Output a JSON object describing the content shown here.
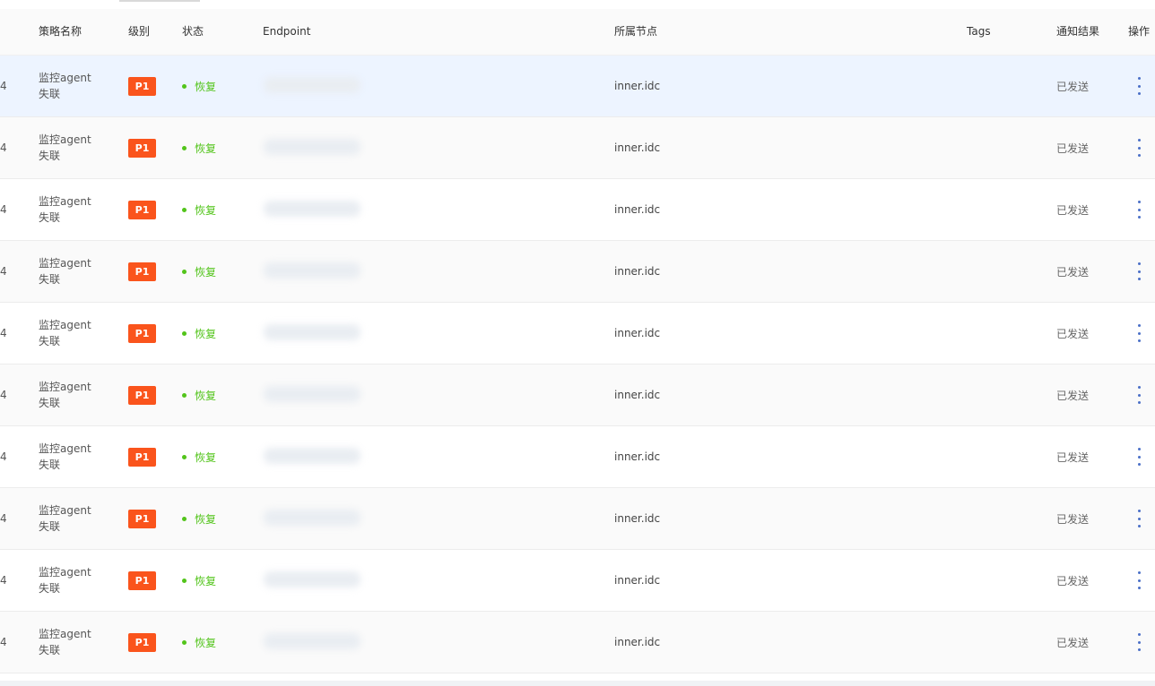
{
  "table": {
    "headers": {
      "name": "策略名称",
      "level": "级别",
      "status": "状态",
      "endpoint": "Endpoint",
      "node": "所属节点",
      "tags": "Tags",
      "notify": "通知结果",
      "operation": "操作"
    },
    "rows": [
      {
        "id": "4",
        "name": "监控agent失联",
        "level": "P1",
        "status": "恢复",
        "node": "inner.idc",
        "tags": "",
        "notify": "已发送"
      },
      {
        "id": "4",
        "name": "监控agent失联",
        "level": "P1",
        "status": "恢复",
        "node": "inner.idc",
        "tags": "",
        "notify": "已发送"
      },
      {
        "id": "4",
        "name": "监控agent失联",
        "level": "P1",
        "status": "恢复",
        "node": "inner.idc",
        "tags": "",
        "notify": "已发送"
      },
      {
        "id": "4",
        "name": "监控agent失联",
        "level": "P1",
        "status": "恢复",
        "node": "inner.idc",
        "tags": "",
        "notify": "已发送"
      },
      {
        "id": "4",
        "name": "监控agent失联",
        "level": "P1",
        "status": "恢复",
        "node": "inner.idc",
        "tags": "",
        "notify": "已发送"
      },
      {
        "id": "4",
        "name": "监控agent失联",
        "level": "P1",
        "status": "恢复",
        "node": "inner.idc",
        "tags": "",
        "notify": "已发送"
      },
      {
        "id": "4",
        "name": "监控agent失联",
        "level": "P1",
        "status": "恢复",
        "node": "inner.idc",
        "tags": "",
        "notify": "已发送"
      },
      {
        "id": "4",
        "name": "监控agent失联",
        "level": "P1",
        "status": "恢复",
        "node": "inner.idc",
        "tags": "",
        "notify": "已发送"
      },
      {
        "id": "4",
        "name": "监控agent失联",
        "level": "P1",
        "status": "恢复",
        "node": "inner.idc",
        "tags": "",
        "notify": "已发送"
      },
      {
        "id": "4",
        "name": "监控agent失联",
        "level": "P1",
        "status": "恢复",
        "node": "inner.idc",
        "tags": "",
        "notify": "已发送"
      }
    ]
  },
  "colors": {
    "level_badge": "#fa541c",
    "status_recovered": "#52c41a",
    "highlight_row": "#edf4ff",
    "more_icon": "#4a6fc7"
  },
  "icons": {
    "operation": "more-vertical-icon",
    "status": "status-dot-icon"
  }
}
